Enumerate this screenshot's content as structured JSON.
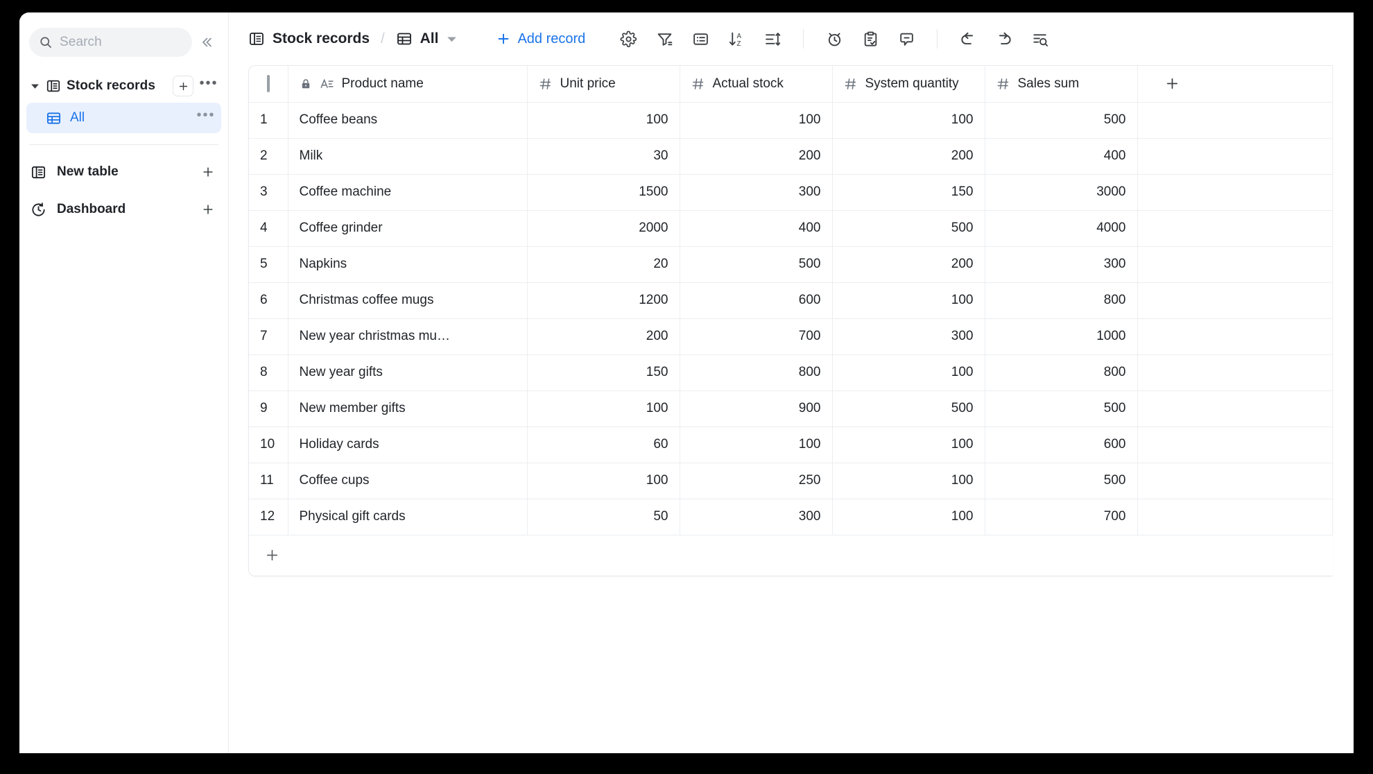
{
  "sidebar": {
    "search": {
      "placeholder": "Search",
      "icon": "search-icon"
    },
    "collapse_icon": "double-chevron-left-icon",
    "table_group": {
      "label": "Stock records",
      "icon": "table-icon",
      "caret_icon": "caret-down-icon",
      "add_label": "+",
      "more_label": "•••"
    },
    "views": [
      {
        "label": "All",
        "icon": "grid-view-icon",
        "more_label": "•••",
        "selected": true
      }
    ],
    "nav": [
      {
        "label": "New table",
        "icon": "table-icon",
        "action_label": "+"
      },
      {
        "label": "Dashboard",
        "icon": "dashboard-clock-icon",
        "action_label": "+"
      }
    ]
  },
  "toolbar": {
    "breadcrumb_table": "Stock records",
    "breadcrumb_table_icon": "table-icon",
    "separator": "/",
    "breadcrumb_view": "All",
    "breadcrumb_view_icon": "grid-view-icon",
    "view_dropdown_icon": "chevron-down-icon",
    "add_record_label": "Add record",
    "add_record_icon": "plus-icon",
    "buttons": [
      {
        "name": "settings-button",
        "icon": "gear-icon"
      },
      {
        "name": "filter-button",
        "icon": "filter-icon"
      },
      {
        "name": "group-button",
        "icon": "list-panel-icon"
      },
      {
        "name": "sort-button",
        "icon": "sort-az-icon"
      },
      {
        "name": "row-height-button",
        "icon": "row-height-icon"
      },
      {
        "name": "history-button",
        "icon": "alarm-clock-icon"
      },
      {
        "name": "form-button",
        "icon": "clipboard-check-icon"
      },
      {
        "name": "comment-button",
        "icon": "comment-icon"
      },
      {
        "name": "undo-button",
        "icon": "undo-icon"
      },
      {
        "name": "redo-button",
        "icon": "redo-icon"
      },
      {
        "name": "search-records-button",
        "icon": "search-rows-icon"
      }
    ]
  },
  "table": {
    "select_all_icon": "checkbox-icon",
    "add_field_label": "+",
    "add_row_label": "+",
    "columns": [
      {
        "key": "name",
        "label": "Product name",
        "type_icon": "text-field-icon",
        "locked": true,
        "lock_icon": "lock-icon",
        "align": "left"
      },
      {
        "key": "price",
        "label": "Unit price",
        "type_icon": "number-icon",
        "locked": false,
        "align": "right"
      },
      {
        "key": "actual",
        "label": "Actual stock",
        "type_icon": "number-icon",
        "locked": false,
        "align": "right"
      },
      {
        "key": "system",
        "label": "System quantity",
        "type_icon": "number-icon",
        "locked": false,
        "align": "right"
      },
      {
        "key": "sales",
        "label": "Sales sum",
        "type_icon": "number-icon",
        "locked": false,
        "align": "right"
      }
    ],
    "rows": [
      {
        "idx": "1",
        "name": "Coffee beans",
        "price": "100",
        "actual": "100",
        "system": "100",
        "sales": "500"
      },
      {
        "idx": "2",
        "name": "Milk",
        "price": "30",
        "actual": "200",
        "system": "200",
        "sales": "400"
      },
      {
        "idx": "3",
        "name": "Coffee machine",
        "price": "1500",
        "actual": "300",
        "system": "150",
        "sales": "3000"
      },
      {
        "idx": "4",
        "name": "Coffee grinder",
        "price": "2000",
        "actual": "400",
        "system": "500",
        "sales": "4000"
      },
      {
        "idx": "5",
        "name": "Napkins",
        "price": "20",
        "actual": "500",
        "system": "200",
        "sales": "300"
      },
      {
        "idx": "6",
        "name": "Christmas coffee mugs",
        "price": "1200",
        "actual": "600",
        "system": "100",
        "sales": "800"
      },
      {
        "idx": "7",
        "name": "New year christmas mu…",
        "price": "200",
        "actual": "700",
        "system": "300",
        "sales": "1000"
      },
      {
        "idx": "8",
        "name": "New year gifts",
        "price": "150",
        "actual": "800",
        "system": "100",
        "sales": "800"
      },
      {
        "idx": "9",
        "name": "New member gifts",
        "price": "100",
        "actual": "900",
        "system": "500",
        "sales": "500"
      },
      {
        "idx": "10",
        "name": "Holiday cards",
        "price": "60",
        "actual": "100",
        "system": "100",
        "sales": "600"
      },
      {
        "idx": "11",
        "name": "Coffee cups",
        "price": "100",
        "actual": "250",
        "system": "100",
        "sales": "500"
      },
      {
        "idx": "12",
        "name": "Physical gift cards",
        "price": "50",
        "actual": "300",
        "system": "100",
        "sales": "700"
      }
    ]
  },
  "colors": {
    "accent": "#1a73e8",
    "selected_bg": "#e8f0fe",
    "text": "#1f2328",
    "muted": "#9aa0a6",
    "border": "#e6e9ed"
  }
}
